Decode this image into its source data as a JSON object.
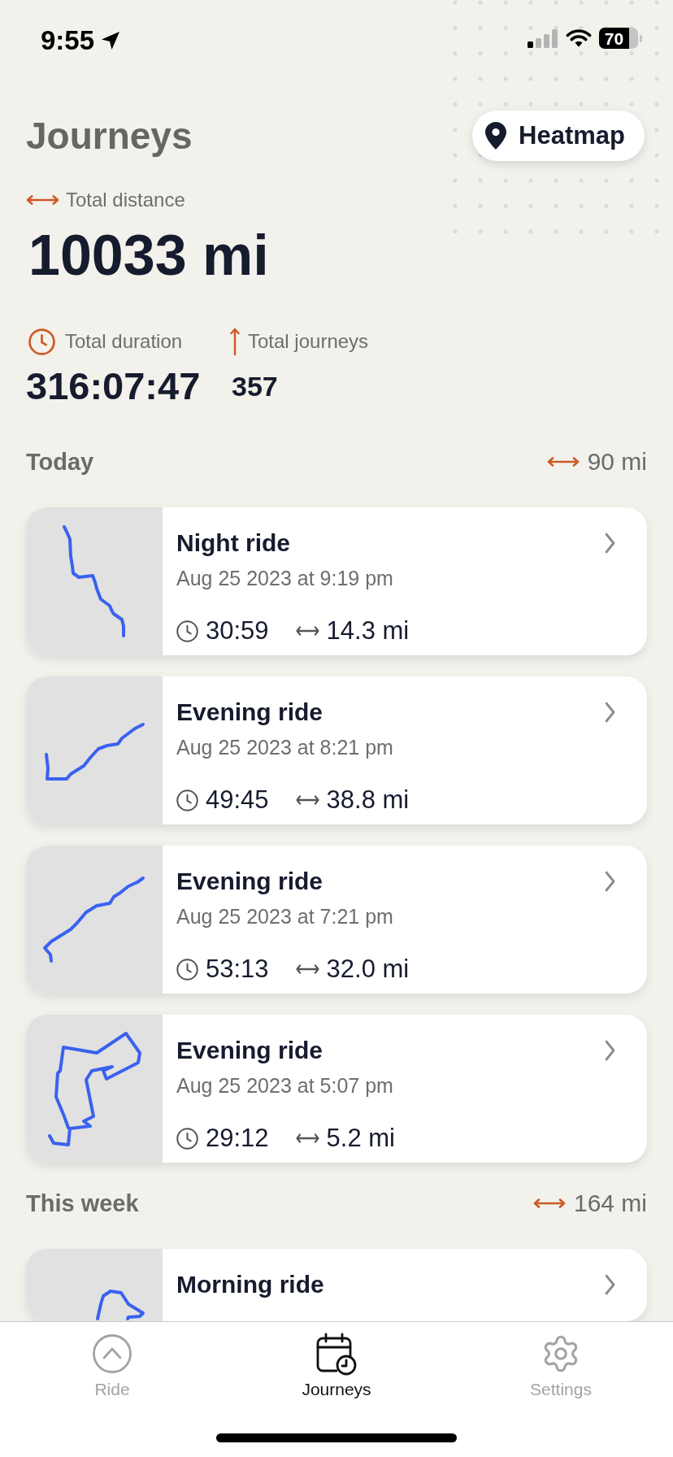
{
  "status_bar": {
    "time": "9:55",
    "battery": "70"
  },
  "header": {
    "title": "Journeys",
    "heatmap_button": "Heatmap"
  },
  "totals": {
    "distance": {
      "label": "Total distance",
      "value": "10033 mi"
    },
    "duration": {
      "label": "Total duration",
      "value": "316:07:47"
    },
    "journeys": {
      "label": "Total journeys",
      "value": "357"
    }
  },
  "sections": [
    {
      "title": "Today",
      "distance": "90 mi",
      "journeys": [
        {
          "name": "Night ride",
          "date": "Aug 25 2023 at 9:19 pm",
          "duration": "30:59",
          "distance": "14.3 mi"
        },
        {
          "name": "Evening ride",
          "date": "Aug 25 2023 at 8:21 pm",
          "duration": "49:45",
          "distance": "38.8 mi"
        },
        {
          "name": "Evening ride",
          "date": "Aug 25 2023 at 7:21 pm",
          "duration": "53:13",
          "distance": "32.0 mi"
        },
        {
          "name": "Evening ride",
          "date": "Aug 25 2023 at 5:07 pm",
          "duration": "29:12",
          "distance": "5.2 mi"
        }
      ]
    },
    {
      "title": "This week",
      "distance": "164 mi",
      "journeys": [
        {
          "name": "Morning ride"
        }
      ]
    }
  ],
  "tab_bar": [
    {
      "label": "Ride",
      "selected": false
    },
    {
      "label": "Journeys",
      "selected": true
    },
    {
      "label": "Settings",
      "selected": false
    }
  ]
}
